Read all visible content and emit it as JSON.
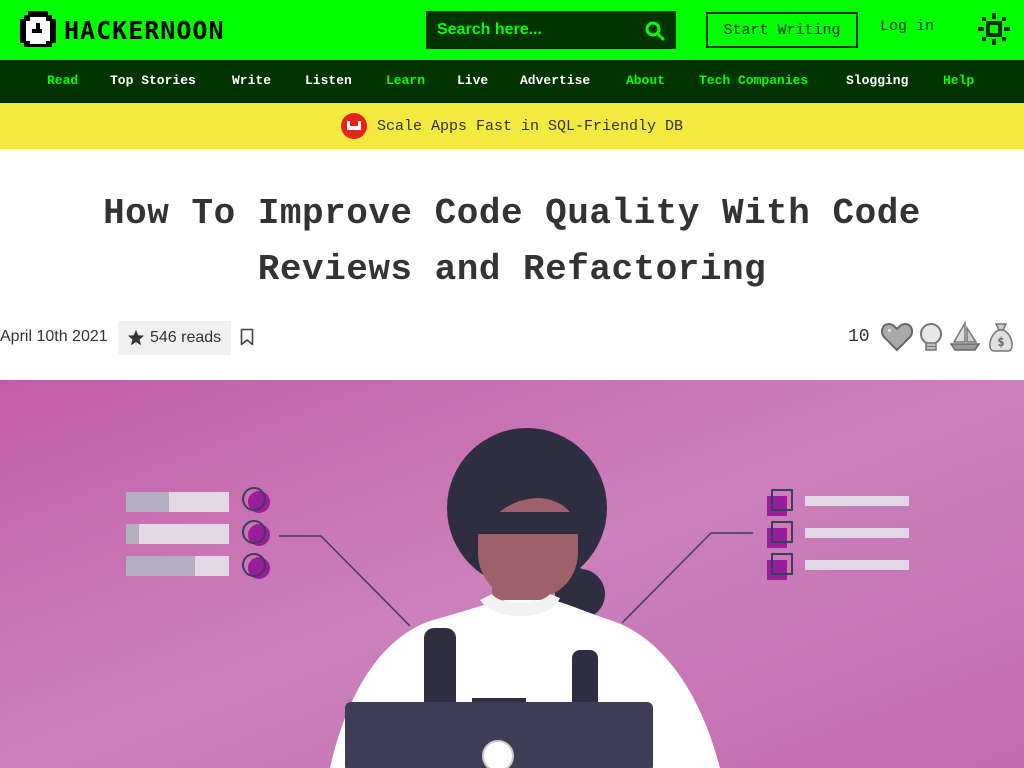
{
  "header": {
    "logo_text": "HACKERNOON",
    "search_placeholder": "Search here...",
    "start_writing": "Start Writing",
    "log_in": "Log in"
  },
  "nav": {
    "items": [
      {
        "label": "Read",
        "color": "#00ff00"
      },
      {
        "label": "Top Stories",
        "color": "#ffffff"
      },
      {
        "label": "Write",
        "color": "#ffffff"
      },
      {
        "label": "Listen",
        "color": "#ffffff"
      },
      {
        "label": "Learn",
        "color": "#00ff00"
      },
      {
        "label": "Live",
        "color": "#ffffff"
      },
      {
        "label": "Advertise",
        "color": "#ffffff"
      },
      {
        "label": "About",
        "color": "#00ff00"
      },
      {
        "label": "Tech Companies",
        "color": "#00ff00"
      },
      {
        "label": "Slogging",
        "color": "#ffffff"
      },
      {
        "label": "Help",
        "color": "#00ff00"
      }
    ]
  },
  "promo": {
    "text": "Scale Apps Fast in SQL-Friendly DB"
  },
  "article": {
    "title": "How To Improve Code Quality With Code Reviews and Refactoring",
    "date": "April 10th 2021",
    "reads": "546 reads",
    "reaction_count": "10"
  },
  "colors": {
    "brand_green": "#00ff00",
    "dark_green": "#003300",
    "promo_yellow": "#f4ea3f",
    "hero_pink": "#c36cb0"
  },
  "icons": {
    "search": "search-icon",
    "theme": "sun-icon",
    "reads": "star-icon",
    "bookmark": "bookmark-icon",
    "reactions": [
      "heart-icon",
      "lightbulb-icon",
      "boat-icon",
      "money-bag-icon"
    ]
  }
}
